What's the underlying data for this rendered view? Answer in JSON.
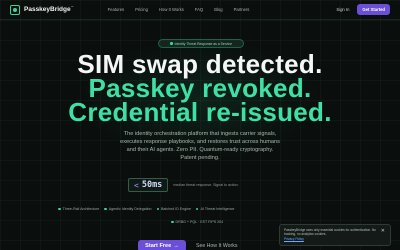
{
  "nav": {
    "brand": "PasskeyBridge",
    "brand_mark": "™",
    "links": [
      "Features",
      "Pricing",
      "How It Works",
      "FAQ",
      "Blog",
      "Partners"
    ],
    "signin": "Sign In",
    "cta": "Get Started"
  },
  "badge": {
    "text": "Identity Threat Response as a Service"
  },
  "hero": {
    "line1": "SIM swap detected.",
    "line2": "Passkey revoked.",
    "line3": "Credential re-issued.",
    "subtitle": "The identity orchestration platform that ingests carrier signals, executes response playbooks, and restores trust across humans and their AI agents. Zero PII. Quantum-ready cryptography. Patent pending."
  },
  "latency": {
    "lt": "<",
    "value": "50ms",
    "note": "median threat response. Signal to action."
  },
  "features": [
    {
      "label": "Three-Rail Architecture"
    },
    {
      "label": "Agentic Identity Delegation"
    },
    {
      "label": "Batched ID Engine"
    },
    {
      "label": "AI Threat Intelligence"
    }
  ],
  "tech": {
    "label": "DRBG + PQL · EST FIPS 204"
  },
  "cta": {
    "start_free": "Start Free",
    "arrow": "→",
    "see_how": "See How It Works"
  },
  "cookie": {
    "text": "PasskeyBridge uses only essential cookies for authentication. No tracking, no analytics cookies.",
    "privacy_link": "Privacy Policy",
    "close": "✕"
  },
  "colors": {
    "accent_green": "#3ee0a4",
    "accent_purple": "#6b4fd8",
    "background": "#0a0f0d"
  }
}
